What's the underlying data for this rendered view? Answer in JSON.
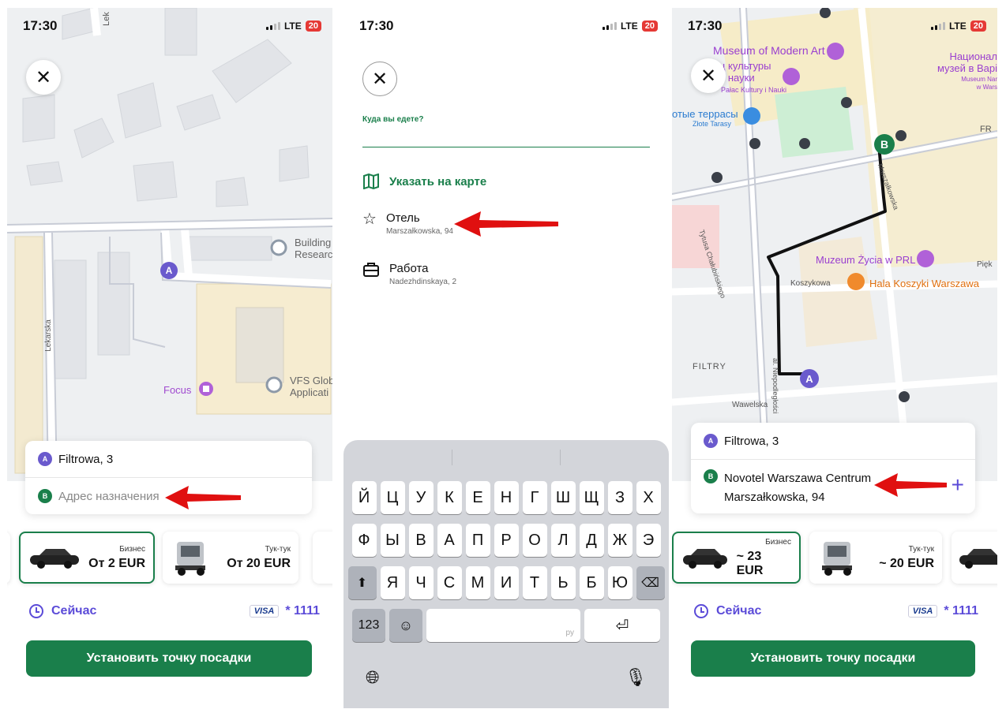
{
  "status": {
    "time": "17:30",
    "network": "LTE",
    "battery": "20"
  },
  "screen1": {
    "map_labels": {
      "street_top": "Lek",
      "street_left": "Lekarska",
      "building": "Building\nResearc",
      "vfs": "VFS Glob\nApplicati",
      "focus": "Focus"
    },
    "pin_a": "A",
    "pin_b": "B",
    "from": "Filtrowa, 3",
    "to_placeholder": "Адрес назначения",
    "tariffs": [
      {
        "name": "Бизнес",
        "price": "От 2 EUR"
      },
      {
        "name": "Тук-тук",
        "price": "От 20 EUR"
      }
    ],
    "time_label": "Сейчас",
    "card_brand": "VISA",
    "card_last": "* 1111",
    "cta": "Установить точку посадки"
  },
  "screen2": {
    "prompt": "Куда вы едете?",
    "map_option": "Указать на карте",
    "favorites": [
      {
        "title": "Отель",
        "subtitle": "Marszałkowska, 94"
      },
      {
        "title": "Работа",
        "subtitle": "Nadezhdinskaya, 2"
      }
    ],
    "keyboard": {
      "row1": [
        "Й",
        "Ц",
        "У",
        "К",
        "Е",
        "Н",
        "Г",
        "Ш",
        "Щ",
        "З",
        "Х"
      ],
      "row2": [
        "Ф",
        "Ы",
        "В",
        "А",
        "П",
        "Р",
        "О",
        "Л",
        "Д",
        "Ж",
        "Э"
      ],
      "row3": [
        "Я",
        "Ч",
        "С",
        "М",
        "И",
        "Т",
        "Ь",
        "Б",
        "Ю"
      ],
      "numbers": "123",
      "space_hint": "ру"
    }
  },
  "screen3": {
    "map_labels": {
      "museum_modern_art": "Museum of Modern Art",
      "palace": "ц культуры\nи науки",
      "palace_pl": "Pałac Kultury i Nauki",
      "terraces": "отые террасы",
      "terraces_pl": "Złote Tarasy",
      "national": "Национал\nмузей в Варі",
      "national_pl": "Museum Nar\nw Wars",
      "street_tytusa": "Tytusa Chałubińskiego",
      "street_marsz": "Marszałkowska",
      "zycia": "Muzeum Życia w PRL",
      "koszykowa": "Koszykowa",
      "hala": "Hala Koszyki Warszawa",
      "filtry": "FILTRY",
      "niepodleglosci": "al. Niepodległości",
      "wawelska": "Wawelska",
      "fr": "FR",
      "piek": "Pięk"
    },
    "from": "Filtrowa, 3",
    "to_title": "Novotel Warszawa Centrum",
    "to_sub": "Marszałkowska, 94",
    "tariffs": [
      {
        "name": "Бизнес",
        "price": "~ 23 EUR"
      },
      {
        "name": "Тук-тук",
        "price": "~ 20 EUR"
      }
    ],
    "time_label": "Сейчас",
    "card_brand": "VISA",
    "card_last": "* 1111",
    "cta": "Установить точку посадки"
  },
  "colors": {
    "brand_green": "#1a7f4b",
    "accent_purple": "#5b4bd8",
    "arrow_red": "#e01010"
  }
}
